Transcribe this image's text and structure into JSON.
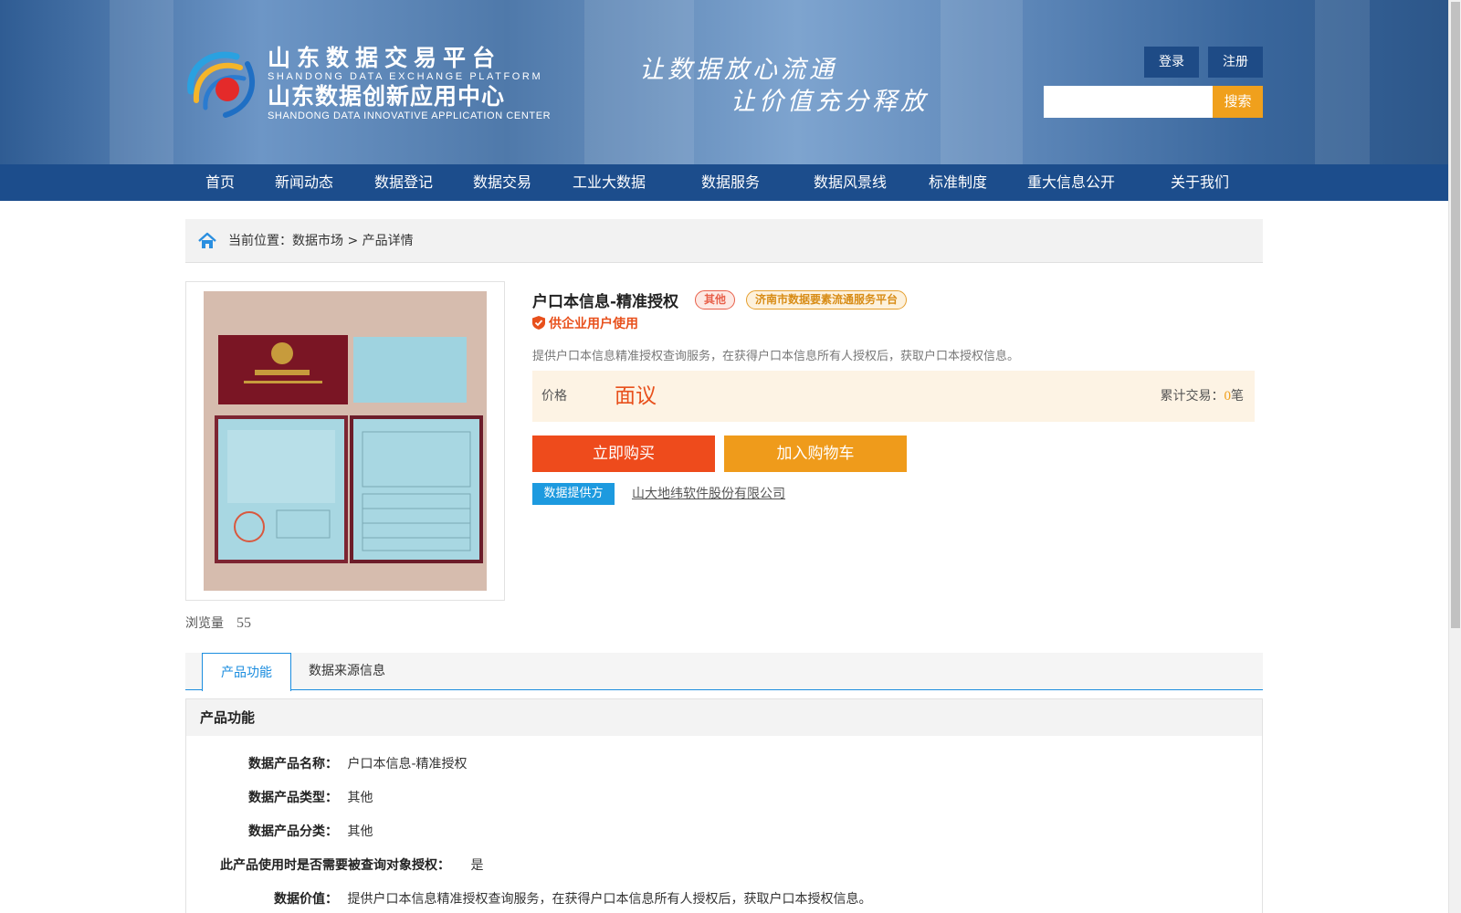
{
  "header": {
    "logo_cn1": "山东数据交易平台",
    "logo_en1": "SHANDONG DATA EXCHANGE PLATFORM",
    "logo_cn2": "山东数据创新应用中心",
    "logo_en2": "SHANDONG DATA INNOVATIVE APPLICATION CENTER",
    "slogan_line1": "让数据放心流通",
    "slogan_line2": "让价值充分释放",
    "login_label": "登录",
    "register_label": "注册",
    "search_placeholder": "",
    "search_label": "搜索"
  },
  "nav": {
    "items": [
      "首页",
      "新闻动态",
      "数据登记",
      "数据交易",
      "工业大数据",
      "数据服务",
      "数据风景线",
      "标准制度",
      "重大信息公开",
      "关于我们"
    ]
  },
  "breadcrumb": {
    "text": "当前位置：数据市场 > 产品详情"
  },
  "product": {
    "title": "户口本信息-精准授权",
    "tag_type": "其他",
    "tag_platform": "济南市数据要素流通服务平台",
    "enterprise_label": "供企业用户使用",
    "description": "提供户口本信息精准授权查询服务，在获得户口本信息所有人授权后，获取户口本授权信息。",
    "price_label": "价格",
    "price_value": "面议",
    "trade_label": "累计交易：",
    "trade_count": "0",
    "trade_unit": "笔",
    "buy_label": "立即购买",
    "cart_label": "加入购物车",
    "provider_badge": "数据提供方",
    "provider_name": "山大地纬软件股份有限公司",
    "views_label": "浏览量",
    "views_count": "55"
  },
  "tabs": {
    "items": [
      "产品功能",
      "数据来源信息"
    ]
  },
  "function": {
    "title": "产品功能",
    "rows": [
      {
        "key": "数据产品名称：",
        "value": "户口本信息-精准授权"
      },
      {
        "key": "数据产品类型：",
        "value": "其他"
      },
      {
        "key": "数据产品分类：",
        "value": "其他"
      },
      {
        "key": "此产品使用时是否需要被查询对象授权：",
        "value": "是"
      },
      {
        "key": "数据价值：",
        "value": "提供户口本信息精准授权查询服务，在获得户口本信息所有人授权后，获取户口本授权信息。"
      }
    ]
  }
}
